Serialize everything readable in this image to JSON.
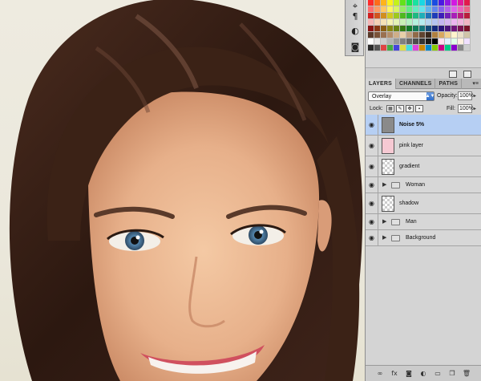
{
  "tools": [
    {
      "name": "sample-tool-icon",
      "glyph": "⌖"
    },
    {
      "name": "paragraph-icon",
      "glyph": "¶"
    },
    {
      "name": "adjustment-icon",
      "glyph": "◐"
    },
    {
      "name": "mask-icon",
      "glyph": "◙"
    }
  ],
  "swatches": {
    "rows": [
      [
        "#ff2a2a",
        "#ff6b1a",
        "#ffb31a",
        "#fff21a",
        "#c4f21a",
        "#62e21a",
        "#1ae24c",
        "#1ae2a0",
        "#1ad7e2",
        "#1a8fe2",
        "#1a4ce2",
        "#4c1ae2",
        "#8f1ae2",
        "#d21ae2",
        "#e21a9b",
        "#e21a4c"
      ],
      [
        "#ff7070",
        "#ff9b63",
        "#ffc863",
        "#fff563",
        "#d9f563",
        "#95ec63",
        "#63ec86",
        "#63ecc0",
        "#63e4ec",
        "#63b3ec",
        "#6386ec",
        "#8663ec",
        "#b363ec",
        "#e063ec",
        "#ec63bd",
        "#ec6386"
      ],
      [
        "#d11f1f",
        "#d1541f",
        "#d18f1f",
        "#d1c81f",
        "#9ec81f",
        "#4fb81f",
        "#1fb83d",
        "#1fb882",
        "#1fafb8",
        "#1f72b8",
        "#1f3db8",
        "#3d1fb8",
        "#721fb8",
        "#a91fb8",
        "#b81f7d",
        "#b81f3d"
      ],
      [
        "#f5b5b5",
        "#f5cfb5",
        "#f5e2b5",
        "#f5f3b5",
        "#e4f3b5",
        "#c8f0b5",
        "#b5f0c4",
        "#b5f0dd",
        "#b5ecf0",
        "#b5d5f0",
        "#b5c4f0",
        "#c4b5f0",
        "#d5b5f0",
        "#ecb5f0",
        "#f0b5de",
        "#f0b5c4"
      ],
      [
        "#8a1414",
        "#8a3614",
        "#8a5e14",
        "#8a8414",
        "#688414",
        "#347a14",
        "#147a29",
        "#147a56",
        "#14747a",
        "#144b7a",
        "#14297a",
        "#29147a",
        "#4b147a",
        "#70147a",
        "#7a1452",
        "#7a1429"
      ],
      [
        "#5a3a2a",
        "#7a5238",
        "#9a7050",
        "#b58e6a",
        "#cfae88",
        "#e8cfa8",
        "#c0a080",
        "#906a48",
        "#604430",
        "#3a2a1e",
        "#b08040",
        "#d8a860",
        "#f0d090",
        "#fff4cc",
        "#eae0c8",
        "#d0c4a8"
      ],
      [
        "#ffffff",
        "#e6e6e6",
        "#cccccc",
        "#b3b3b3",
        "#999999",
        "#808080",
        "#666666",
        "#4d4d4d",
        "#333333",
        "#1a1a1a",
        "#000000",
        "#ffe0f0",
        "#e0f0ff",
        "#e0ffe8",
        "#fff0e0",
        "#f0e0ff"
      ],
      [
        "#2a2a2a",
        "#555555",
        "#d44",
        "#4a4",
        "#44d",
        "#dd4",
        "#4dd",
        "#d4d",
        "#c80",
        "#08c",
        "#8c0",
        "#c08",
        "#0c8",
        "#80c",
        "#888",
        "#ccc"
      ]
    ],
    "footer_icons": [
      "new-swatch-icon",
      "delete-swatch-icon"
    ]
  },
  "layers_panel": {
    "tabs": [
      "LAYERS",
      "CHANNELS",
      "PATHS"
    ],
    "menu_glyph": "▾≡",
    "blend_mode": "Overlay",
    "opacity_label": "Opacity:",
    "opacity_value": "100%",
    "lock_label": "Lock:",
    "fill_label": "Fill:",
    "fill_value": "100%",
    "layers": [
      {
        "name": "Noise 5%",
        "kind": "grey",
        "selected": true,
        "group": false
      },
      {
        "name": "pink layer",
        "kind": "pink",
        "selected": false,
        "group": false
      },
      {
        "name": "gradient",
        "kind": "checker",
        "selected": false,
        "group": false
      },
      {
        "name": "Woman",
        "kind": "group",
        "selected": false,
        "group": true
      },
      {
        "name": "shadow",
        "kind": "checker",
        "selected": false,
        "group": false
      },
      {
        "name": "Man",
        "kind": "group",
        "selected": false,
        "group": true
      },
      {
        "name": "Background",
        "kind": "group",
        "selected": false,
        "group": true
      }
    ],
    "footer_icons": [
      {
        "name": "link-layers-icon",
        "glyph": "∞"
      },
      {
        "name": "layer-style-icon",
        "glyph": "fx"
      },
      {
        "name": "layer-mask-icon",
        "glyph": "◙"
      },
      {
        "name": "adjustment-layer-icon",
        "glyph": "◐"
      },
      {
        "name": "new-group-icon",
        "glyph": "▭"
      },
      {
        "name": "new-layer-icon",
        "glyph": "❐"
      },
      {
        "name": "delete-layer-icon",
        "glyph": "🗑"
      }
    ]
  },
  "colors": {
    "selection": "#b6cff3",
    "panel": "#d4d4d4",
    "hair": "#3a2218",
    "skin": "#e9b48e"
  }
}
